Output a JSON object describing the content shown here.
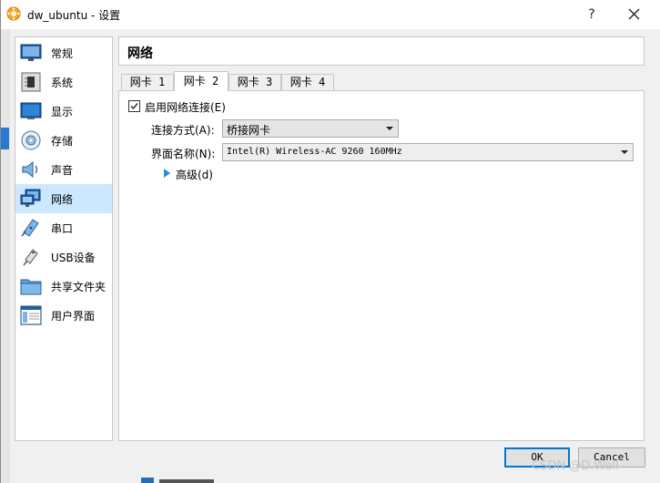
{
  "window": {
    "title": "dw_ubuntu - 设置",
    "help_label": "?"
  },
  "sidebar": {
    "items": [
      {
        "label": "常规"
      },
      {
        "label": "系统"
      },
      {
        "label": "显示"
      },
      {
        "label": "存储"
      },
      {
        "label": "声音"
      },
      {
        "label": "网络"
      },
      {
        "label": "串口"
      },
      {
        "label": "USB设备"
      },
      {
        "label": "共享文件夹"
      },
      {
        "label": "用户界面"
      }
    ],
    "selected": "网络"
  },
  "page": {
    "title": "网络"
  },
  "tabs": [
    {
      "label": "网卡 1"
    },
    {
      "label": "网卡 2"
    },
    {
      "label": "网卡 3"
    },
    {
      "label": "网卡 4"
    }
  ],
  "adapter": {
    "enable_label": "启用网络连接(E)",
    "enabled": true,
    "attached_to_label": "连接方式(A):",
    "attached_to_value": "桥接网卡",
    "name_label": "界面名称(N):",
    "name_value": "Intel(R) Wireless-AC 9260 160MHz",
    "advanced_label": "高级(d)"
  },
  "buttons": {
    "ok": "OK",
    "cancel": "Cancel"
  },
  "watermark": "CSDN @D.Well",
  "colors": {
    "selection": "#cce8ff",
    "accent": "#0078d7",
    "expander": "#1e90e0"
  }
}
